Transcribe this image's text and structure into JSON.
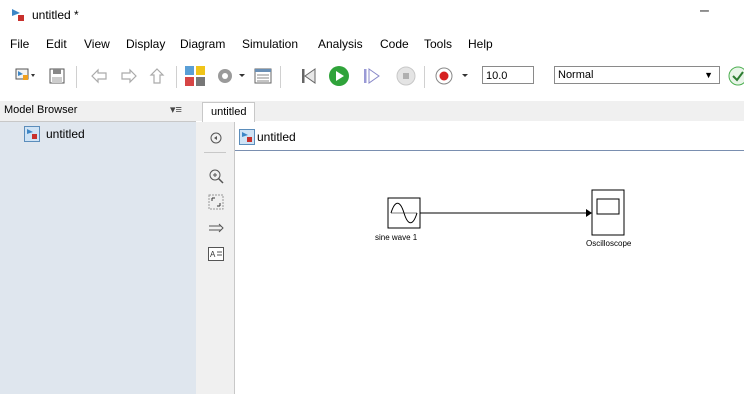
{
  "window": {
    "title": "untitled *",
    "minimize_glyph": "–"
  },
  "menu": [
    "File",
    "Edit",
    "View",
    "Display",
    "Diagram",
    "Simulation",
    "Analysis",
    "Code",
    "Tools",
    "Help"
  ],
  "toolbar": {
    "stop_time": "10.0",
    "sim_mode": "Normal",
    "icons": [
      "new-model-icon",
      "save-icon",
      "back-icon",
      "forward-icon",
      "up-icon",
      "library-browser-icon",
      "model-settings-icon",
      "model-explorer-icon",
      "step-back-icon",
      "run-icon",
      "step-forward-icon",
      "stop-icon",
      "record-icon",
      "check-icon"
    ]
  },
  "model_browser": {
    "header": "Model Browser",
    "menu_glyph": "▾≡",
    "tree": [
      {
        "label": "untitled"
      }
    ]
  },
  "tabs": [
    {
      "label": "untitled"
    }
  ],
  "address_bar": {
    "label": "untitled"
  },
  "palette": [
    "hide-show-icon",
    "zoom-icon",
    "fit-to-view-icon",
    "connect-arrow-icon",
    "annotation-icon"
  ],
  "diagram": {
    "blocks": [
      {
        "name": "sine wave 1",
        "kind": "sine-wave"
      },
      {
        "name": "Oscilloscope",
        "kind": "scope"
      }
    ]
  },
  "colors": {
    "model_icon_blue": "#3d86c6",
    "model_icon_red": "#c8302c",
    "run_green": "#2fa33a",
    "record_red": "#d62020",
    "browser_bg": "#dfe6ee"
  }
}
